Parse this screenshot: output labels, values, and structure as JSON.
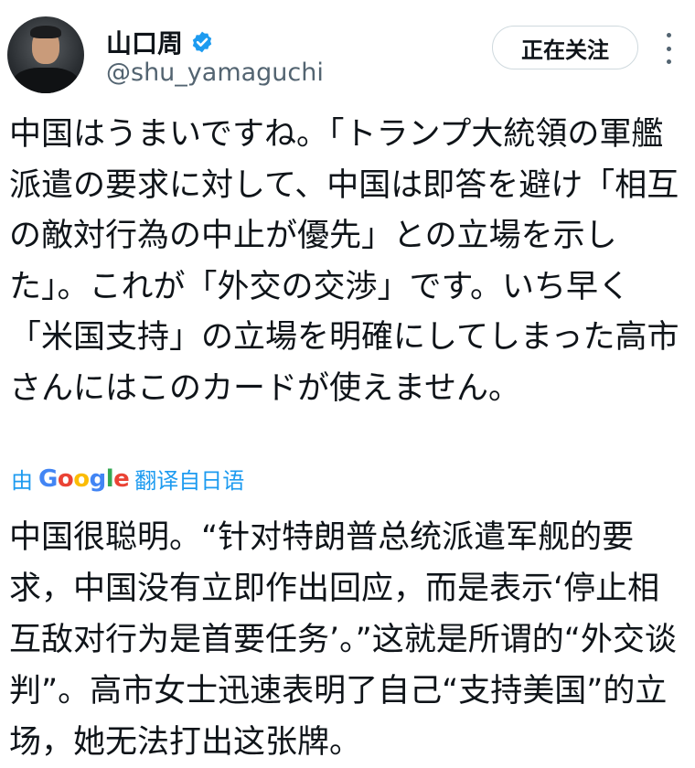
{
  "author": {
    "display_name": "山口周",
    "handle": "@shu_yamaguchi",
    "verified": true,
    "avatar_icon": "user-avatar-photo",
    "verified_icon": "verified-badge-icon",
    "verified_color": "#1d9bf0"
  },
  "actions": {
    "follow_label": "正在关注",
    "more_icon": "more-vertical-icon"
  },
  "tweet": {
    "text": "中国はうまいですね。「トランプ大統領の軍艦派遣の要求に対して、中国は即答を避け「相互の敵対行為の中止が優先」との立場を示した」。これが「外交の交渉」です。いち早く「米国支持」の立場を明確にしてしまった高市さんにはこのカードが使えません。"
  },
  "translation": {
    "prefix": "由",
    "provider": "Google",
    "suffix": "翻译自日语",
    "text": "中国很聪明。“针对特朗普总统派遣军舰的要求，中国没有立即作出回应，而是表示‘停止相互敌对行为是首要任务’。”这就是所谓的“外交谈判”。高市女士迅速表明了自己“支持美国”的立场，她无法打出这张牌。"
  },
  "colors": {
    "accent": "#1d9bf0",
    "text": "#0f1419",
    "secondary_text": "#536471",
    "border": "#cfd9de"
  }
}
